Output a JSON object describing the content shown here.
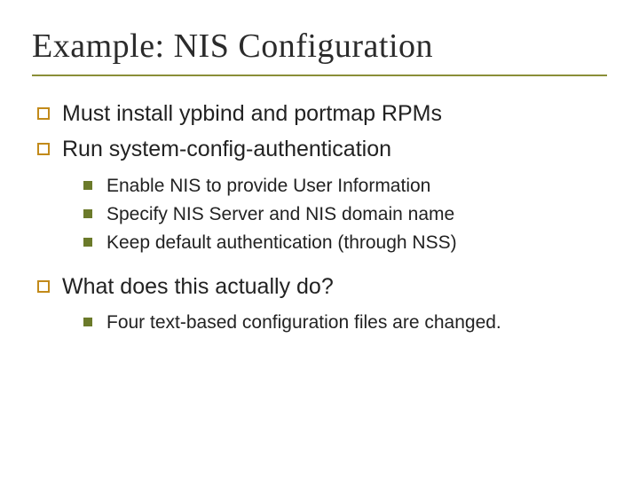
{
  "title": "Example: NIS Configuration",
  "bullets": {
    "b0": "Must install ypbind and portmap RPMs",
    "b1": "Run system-config-authentication",
    "b1_sub": {
      "s0": "Enable NIS to provide User Information",
      "s1": "Specify NIS Server and NIS domain name",
      "s2": "Keep default authentication (through NSS)"
    },
    "b2": "What does this actually do?",
    "b2_sub": {
      "s0": "Four text-based configuration files are changed."
    }
  }
}
